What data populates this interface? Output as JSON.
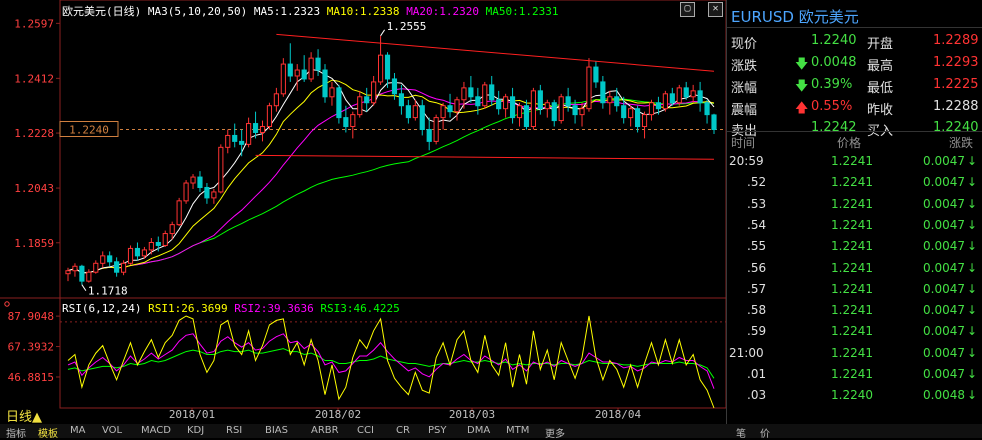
{
  "window_buttons": [
    "▢",
    "✕"
  ],
  "title": {
    "symbol_label": "欧元美元(日线)",
    "ma_params": "MA3(5,10,20,50)",
    "ma5": "MA5:1.2323",
    "ma10": "MA10:1.2338",
    "ma20": "MA20:1.2320",
    "ma50": "MA50:1.2331"
  },
  "rsi_title": {
    "params": "RSI(6,12,24)",
    "rsi1": "RSI1:26.3699",
    "rsi2": "RSI2:39.3636",
    "rsi3": "RSI3:46.4225"
  },
  "annotations": {
    "high_label": "1.2555",
    "low_label": "1.1718",
    "current_tag": "1.2240"
  },
  "quote_panel": {
    "title": "EURUSD 欧元美元",
    "rows": [
      {
        "l1": "现价",
        "v1": "1.2240",
        "l2": "开盘",
        "v2": "1.2289"
      },
      {
        "l1": "涨跌",
        "v1": "0.0048",
        "l2": "最高",
        "v2": "1.2293"
      },
      {
        "l1": "涨幅",
        "v1": "0.39%",
        "l2": "最低",
        "v2": "1.2225"
      },
      {
        "l1": "震幅",
        "v1": "0.55%",
        "l2": "昨收",
        "v2": "1.2288"
      },
      {
        "l1": "卖出",
        "v1": "1.2242",
        "l2": "买入",
        "v2": "1.2240"
      }
    ],
    "tick_headers": {
      "time": "时间",
      "price": "价格",
      "change": "涨跌"
    },
    "ticks": [
      {
        "time": "20:59",
        "price": "1.2241",
        "chg": "0.0047"
      },
      {
        "time": ".52",
        "price": "1.2241",
        "chg": "0.0047"
      },
      {
        "time": ".53",
        "price": "1.2241",
        "chg": "0.0047"
      },
      {
        "time": ".54",
        "price": "1.2241",
        "chg": "0.0047"
      },
      {
        "time": ".55",
        "price": "1.2241",
        "chg": "0.0047"
      },
      {
        "time": ".56",
        "price": "1.2241",
        "chg": "0.0047"
      },
      {
        "time": ".57",
        "price": "1.2241",
        "chg": "0.0047"
      },
      {
        "time": ".58",
        "price": "1.2241",
        "chg": "0.0047"
      },
      {
        "time": ".59",
        "price": "1.2241",
        "chg": "0.0047"
      },
      {
        "time": "21:00",
        "price": "1.2241",
        "chg": "0.0047"
      },
      {
        "time": ".01",
        "price": "1.2241",
        "chg": "0.0047"
      },
      {
        "time": ".03",
        "price": "1.2240",
        "chg": "0.0048"
      }
    ]
  },
  "period_label": "日线▲",
  "bottom_tabs": [
    "指标",
    "模板",
    "MA",
    "VOL",
    "MACD",
    "KDJ",
    "RSI",
    "BIAS",
    "ARBR",
    "CCI",
    "CR",
    "PSY",
    "DMA",
    "MTM",
    "更多"
  ],
  "right_tabs": [
    "笔",
    "价"
  ],
  "colors": {
    "up": "#ff3333",
    "down": "#00c8c8",
    "ma5": "#ffffff",
    "ma10": "#ffff00",
    "ma20": "#ff00ff",
    "ma50": "#00ff00",
    "trend": "#ff2020",
    "grid": "#8a2020"
  },
  "chart_data": [
    {
      "type": "candlestick",
      "title": "欧元美元(日线)",
      "x_ticks": [
        "2018/01",
        "2018/02",
        "2018/03",
        "2018/04"
      ],
      "y_ticks": [
        "1.2597",
        "1.2412",
        "1.2228",
        "1.2043",
        "1.1859"
      ],
      "ylim": [
        1.168,
        1.2615
      ],
      "candles": [
        [
          1.1755,
          1.1775,
          1.173,
          1.1765
        ],
        [
          1.1765,
          1.179,
          1.1745,
          1.178
        ],
        [
          1.178,
          1.1785,
          1.1718,
          1.173
        ],
        [
          1.173,
          1.177,
          1.1725,
          1.176
        ],
        [
          1.176,
          1.18,
          1.1755,
          1.179
        ],
        [
          1.179,
          1.183,
          1.1775,
          1.1815
        ],
        [
          1.1815,
          1.183,
          1.178,
          1.1795
        ],
        [
          1.1795,
          1.181,
          1.1745,
          1.176
        ],
        [
          1.176,
          1.18,
          1.175,
          1.179
        ],
        [
          1.179,
          1.185,
          1.1785,
          1.184
        ],
        [
          1.184,
          1.186,
          1.18,
          1.1815
        ],
        [
          1.1815,
          1.1845,
          1.1805,
          1.1835
        ],
        [
          1.1835,
          1.1875,
          1.182,
          1.186
        ],
        [
          1.186,
          1.188,
          1.183,
          1.185
        ],
        [
          1.185,
          1.19,
          1.1845,
          1.189
        ],
        [
          1.189,
          1.193,
          1.187,
          1.192
        ],
        [
          1.192,
          1.201,
          1.1915,
          1.2
        ],
        [
          1.2,
          1.207,
          1.199,
          1.206
        ],
        [
          1.206,
          1.209,
          1.204,
          1.208
        ],
        [
          1.208,
          1.21,
          1.203,
          1.2045
        ],
        [
          1.2045,
          1.206,
          1.199,
          1.201
        ],
        [
          1.201,
          1.204,
          1.199,
          1.203
        ],
        [
          1.203,
          1.219,
          1.2025,
          1.218
        ],
        [
          1.218,
          1.224,
          1.216,
          1.222
        ],
        [
          1.222,
          1.226,
          1.218,
          1.22
        ],
        [
          1.22,
          1.224,
          1.215,
          1.219
        ],
        [
          1.219,
          1.228,
          1.218,
          1.226
        ],
        [
          1.226,
          1.23,
          1.221,
          1.223
        ],
        [
          1.223,
          1.227,
          1.22,
          1.225
        ],
        [
          1.225,
          1.233,
          1.224,
          1.232
        ],
        [
          1.232,
          1.238,
          1.23,
          1.236
        ],
        [
          1.236,
          1.248,
          1.235,
          1.246
        ],
        [
          1.246,
          1.253,
          1.24,
          1.242
        ],
        [
          1.242,
          1.246,
          1.237,
          1.244
        ],
        [
          1.244,
          1.249,
          1.24,
          1.241
        ],
        [
          1.241,
          1.25,
          1.24,
          1.248
        ],
        [
          1.248,
          1.251,
          1.242,
          1.244
        ],
        [
          1.244,
          1.246,
          1.233,
          1.235
        ],
        [
          1.235,
          1.24,
          1.232,
          1.238
        ],
        [
          1.238,
          1.239,
          1.226,
          1.228
        ],
        [
          1.228,
          1.232,
          1.223,
          1.225
        ],
        [
          1.225,
          1.23,
          1.221,
          1.229
        ],
        [
          1.229,
          1.237,
          1.228,
          1.235
        ],
        [
          1.235,
          1.238,
          1.23,
          1.233
        ],
        [
          1.233,
          1.242,
          1.232,
          1.24
        ],
        [
          1.24,
          1.2555,
          1.239,
          1.249
        ],
        [
          1.249,
          1.25,
          1.238,
          1.241
        ],
        [
          1.241,
          1.243,
          1.234,
          1.236
        ],
        [
          1.236,
          1.239,
          1.229,
          1.232
        ],
        [
          1.232,
          1.234,
          1.226,
          1.228
        ],
        [
          1.228,
          1.234,
          1.227,
          1.232
        ],
        [
          1.232,
          1.234,
          1.222,
          1.224
        ],
        [
          1.224,
          1.228,
          1.217,
          1.22
        ],
        [
          1.22,
          1.229,
          1.219,
          1.228
        ],
        [
          1.228,
          1.233,
          1.224,
          1.232
        ],
        [
          1.232,
          1.236,
          1.228,
          1.23
        ],
        [
          1.23,
          1.235,
          1.227,
          1.234
        ],
        [
          1.234,
          1.24,
          1.231,
          1.238
        ],
        [
          1.238,
          1.242,
          1.233,
          1.235
        ],
        [
          1.235,
          1.238,
          1.229,
          1.232
        ],
        [
          1.232,
          1.24,
          1.231,
          1.239
        ],
        [
          1.239,
          1.242,
          1.232,
          1.234
        ],
        [
          1.234,
          1.237,
          1.229,
          1.231
        ],
        [
          1.231,
          1.236,
          1.228,
          1.235
        ],
        [
          1.235,
          1.238,
          1.226,
          1.228
        ],
        [
          1.228,
          1.233,
          1.225,
          1.232
        ],
        [
          1.232,
          1.234,
          1.224,
          1.225
        ],
        [
          1.225,
          1.238,
          1.224,
          1.237
        ],
        [
          1.237,
          1.239,
          1.229,
          1.231
        ],
        [
          1.231,
          1.234,
          1.228,
          1.233
        ],
        [
          1.233,
          1.234,
          1.225,
          1.227
        ],
        [
          1.227,
          1.236,
          1.226,
          1.235
        ],
        [
          1.235,
          1.238,
          1.23,
          1.232
        ],
        [
          1.232,
          1.234,
          1.226,
          1.229
        ],
        [
          1.229,
          1.233,
          1.225,
          1.231
        ],
        [
          1.231,
          1.248,
          1.23,
          1.245
        ],
        [
          1.245,
          1.247,
          1.238,
          1.24
        ],
        [
          1.24,
          1.242,
          1.231,
          1.233
        ],
        [
          1.233,
          1.237,
          1.229,
          1.235
        ],
        [
          1.235,
          1.238,
          1.23,
          1.232
        ],
        [
          1.232,
          1.235,
          1.226,
          1.228
        ],
        [
          1.228,
          1.232,
          1.225,
          1.231
        ],
        [
          1.231,
          1.232,
          1.223,
          1.225
        ],
        [
          1.225,
          1.23,
          1.221,
          1.229
        ],
        [
          1.229,
          1.234,
          1.227,
          1.233
        ],
        [
          1.233,
          1.235,
          1.229,
          1.231
        ],
        [
          1.231,
          1.237,
          1.23,
          1.236
        ],
        [
          1.236,
          1.238,
          1.232,
          1.233
        ],
        [
          1.233,
          1.239,
          1.232,
          1.238
        ],
        [
          1.238,
          1.24,
          1.234,
          1.235
        ],
        [
          1.235,
          1.239,
          1.233,
          1.237
        ],
        [
          1.237,
          1.24,
          1.23,
          1.233
        ],
        [
          1.233,
          1.234,
          1.226,
          1.229
        ],
        [
          1.2289,
          1.2293,
          1.2225,
          1.224
        ]
      ],
      "trendlines": [
        {
          "from": {
            "index": 30,
            "price": 1.256
          },
          "to": {
            "index": 93,
            "price": 1.2436
          }
        },
        {
          "from": {
            "index": 27,
            "price": 1.2153
          },
          "to": {
            "index": 93,
            "price": 1.214
          }
        }
      ]
    },
    {
      "type": "line",
      "title": "RSI(6,12,24)",
      "y_ticks": [
        "87.9048",
        "67.3932",
        "46.8815"
      ],
      "ylim": [
        28,
        90
      ],
      "series": [
        {
          "name": "RSI1",
          "color": "#ffff00",
          "values": [
            58,
            62,
            40,
            55,
            63,
            68,
            56,
            45,
            58,
            70,
            55,
            64,
            72,
            60,
            70,
            75,
            85,
            88,
            86,
            62,
            50,
            58,
            82,
            85,
            68,
            62,
            78,
            58,
            68,
            82,
            85,
            86,
            62,
            70,
            55,
            72,
            58,
            35,
            55,
            32,
            40,
            60,
            72,
            66,
            78,
            86,
            58,
            46,
            40,
            35,
            50,
            38,
            36,
            60,
            70,
            55,
            72,
            78,
            58,
            50,
            75,
            55,
            48,
            70,
            40,
            62,
            42,
            78,
            52,
            65,
            45,
            70,
            58,
            46,
            60,
            88,
            60,
            45,
            58,
            52,
            40,
            55,
            40,
            56,
            70,
            55,
            72,
            56,
            72,
            55,
            62,
            45,
            38,
            26
          ]
        },
        {
          "name": "RSI2",
          "color": "#ff00ff",
          "values": [
            55,
            57,
            48,
            53,
            57,
            60,
            56,
            51,
            55,
            61,
            56,
            59,
            63,
            59,
            62,
            65,
            71,
            75,
            76,
            69,
            63,
            64,
            71,
            74,
            70,
            67,
            70,
            65,
            66,
            71,
            74,
            76,
            70,
            71,
            66,
            69,
            64,
            55,
            57,
            50,
            51,
            56,
            61,
            61,
            65,
            70,
            64,
            59,
            55,
            51,
            53,
            49,
            47,
            52,
            56,
            55,
            59,
            62,
            58,
            56,
            61,
            58,
            55,
            59,
            52,
            55,
            51,
            57,
            55,
            57,
            54,
            58,
            56,
            54,
            56,
            63,
            60,
            57,
            57,
            56,
            53,
            54,
            51,
            53,
            57,
            56,
            58,
            57,
            60,
            58,
            58,
            54,
            51,
            39
          ]
        },
        {
          "name": "RSI3",
          "color": "#00ff00",
          "values": [
            52,
            53,
            51,
            52,
            53,
            54,
            54,
            53,
            54,
            56,
            55,
            56,
            58,
            57,
            58,
            60,
            62,
            64,
            65,
            64,
            62,
            62,
            64,
            65,
            64,
            64,
            65,
            63,
            63,
            64,
            65,
            66,
            64,
            64,
            62,
            63,
            61,
            58,
            58,
            56,
            56,
            57,
            58,
            58,
            59,
            61,
            59,
            58,
            57,
            56,
            56,
            55,
            54,
            55,
            56,
            56,
            57,
            58,
            57,
            57,
            58,
            57,
            56,
            57,
            55,
            56,
            55,
            56,
            56,
            56,
            55,
            56,
            56,
            55,
            56,
            58,
            57,
            56,
            56,
            56,
            55,
            55,
            54,
            55,
            56,
            56,
            56,
            56,
            57,
            56,
            56,
            55,
            53,
            46
          ]
        }
      ]
    }
  ]
}
